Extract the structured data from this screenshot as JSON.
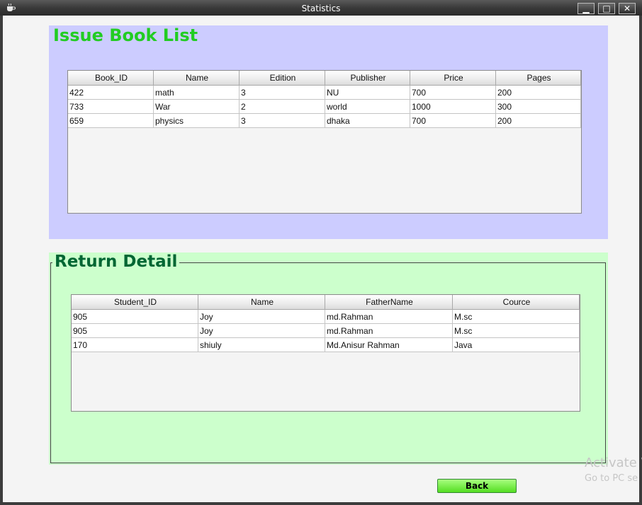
{
  "window": {
    "title": "Statistics",
    "minimize": "▁",
    "maximize": "□",
    "close": "✕"
  },
  "issue": {
    "heading": "Issue Book List",
    "columns": [
      "Book_ID",
      "Name",
      "Edition",
      "Publisher",
      "Price",
      "Pages"
    ],
    "rows": [
      [
        "422",
        "math",
        "3",
        "NU",
        "700",
        "200"
      ],
      [
        "733",
        "War",
        "2",
        "world",
        "1000",
        "300"
      ],
      [
        "659",
        "physics",
        "3",
        "dhaka",
        "700",
        "200"
      ]
    ]
  },
  "return": {
    "heading": "Return Detail",
    "columns": [
      "Student_ID",
      "Name",
      "FatherName",
      "Cource"
    ],
    "rows": [
      [
        "905",
        "Joy",
        "md.Rahman",
        "M.sc"
      ],
      [
        "905",
        "Joy",
        "md.Rahman",
        "M.sc"
      ],
      [
        "170",
        "shiuly",
        "Md.Anisur Rahman",
        "Java"
      ]
    ]
  },
  "back_button": "Back",
  "watermark": {
    "line1": "Activate W",
    "line2": "Go to PC se"
  },
  "colors": {
    "issue_panel": "#ccccff",
    "issue_heading": "#22cc22",
    "return_panel": "#ccffcc",
    "return_heading": "#006633",
    "back_button": "#66ee33"
  }
}
